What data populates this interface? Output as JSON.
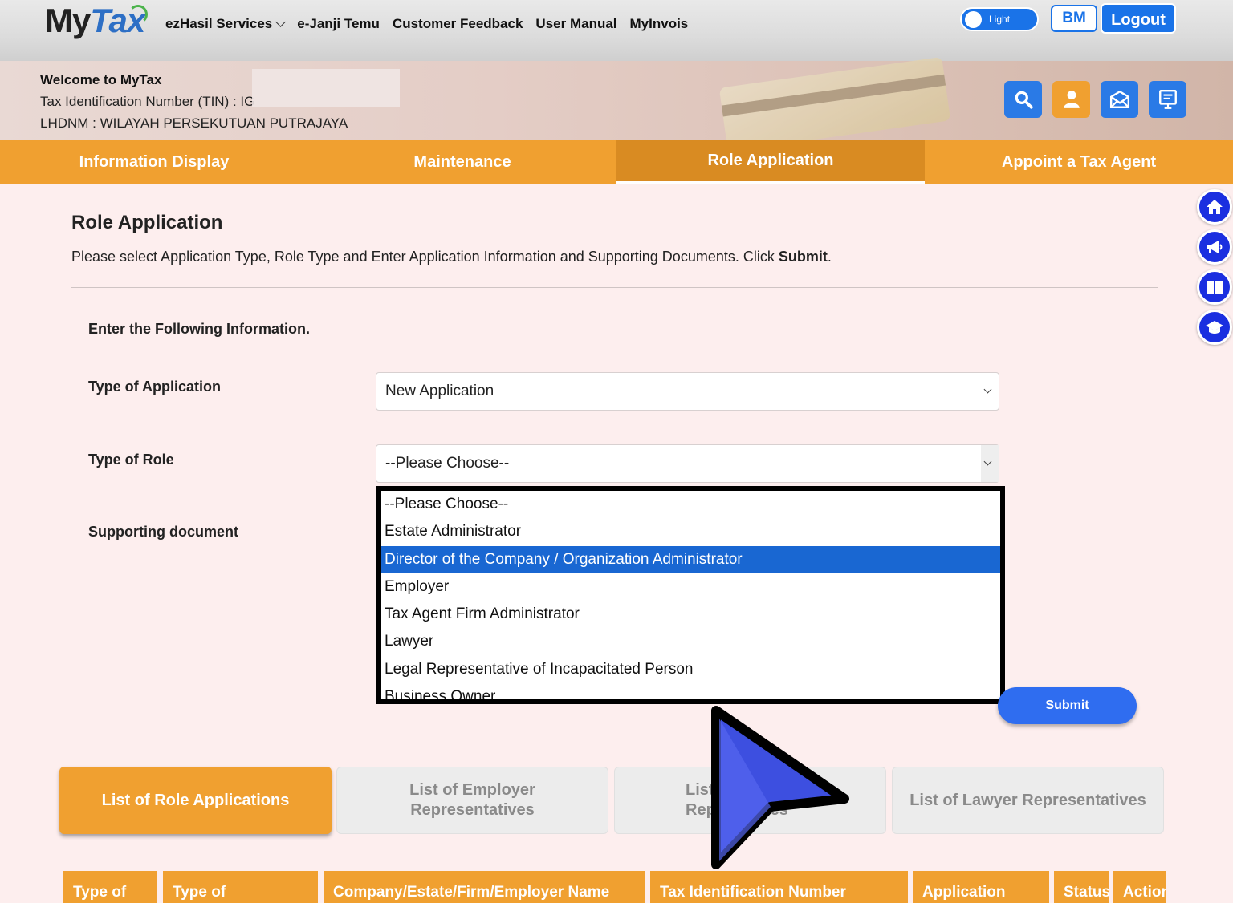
{
  "topnav": {
    "logo_my": "My",
    "logo_tax": "Tax",
    "items": [
      {
        "label": "ezHasil Services",
        "has_dropdown": true
      },
      {
        "label": "e-Janji Temu"
      },
      {
        "label": "Customer Feedback"
      },
      {
        "label": "User Manual"
      },
      {
        "label": "MyInvois"
      }
    ],
    "theme_toggle_label": "Light",
    "bm_label": "BM",
    "logout_label": "Logout"
  },
  "banner": {
    "welcome": "Welcome to MyTax",
    "tin": "Tax Identification Number (TIN) : IG",
    "lhdnm": "LHDNM : WILAYAH PERSEKUTUAN PUTRAJAYA",
    "icons": [
      "search-icon",
      "user-icon",
      "mail-icon",
      "presentation-icon"
    ]
  },
  "tabs": [
    {
      "label": "Information Display",
      "active": false
    },
    {
      "label": "Maintenance",
      "active": false
    },
    {
      "label": "Role Application",
      "active": true
    },
    {
      "label": "Appoint a Tax Agent",
      "active": false
    }
  ],
  "float_icons": [
    "home-icon",
    "megaphone-icon",
    "book-icon",
    "graduation-cap-icon"
  ],
  "main": {
    "title": "Role Application",
    "desc_prefix": "Please select Application Type, Role Type and Enter Application Information and Supporting Documents. Click ",
    "desc_bold": "Submit",
    "desc_suffix": ".",
    "section_label": "Enter the Following Information.",
    "type_of_application_label": "Type of Application",
    "type_of_application_value": "New Application",
    "type_of_role_label": "Type of Role",
    "type_of_role_value": "--Please Choose--",
    "supporting_doc_label": "Supporting document",
    "submit_label": "Submit"
  },
  "role_options": [
    {
      "label": "--Please Choose--",
      "selected": false
    },
    {
      "label": "Estate Administrator",
      "selected": false
    },
    {
      "label": "Director of the Company / Organization Administrator",
      "selected": true
    },
    {
      "label": "Employer",
      "selected": false
    },
    {
      "label": "Tax Agent Firm Administrator",
      "selected": false
    },
    {
      "label": "Lawyer",
      "selected": false
    },
    {
      "label": "Legal Representative of Incapacitated Person",
      "selected": false
    },
    {
      "label": "Business Owner",
      "selected": false
    }
  ],
  "list_tabs": [
    {
      "line1": "List of Role Applications",
      "line2": "",
      "active": true
    },
    {
      "line1": "List of Employer",
      "line2": "Representatives",
      "active": false
    },
    {
      "line1": "List",
      "line2": "Rep      atives",
      "active": false
    },
    {
      "line1": "List of Lawyer Representatives",
      "line2": "",
      "active": false
    }
  ],
  "table_headers": [
    "Type of",
    "Type of",
    "Company/Estate/Firm/Employer Name",
    "Tax Identification Number",
    "Application",
    "Status",
    "Action"
  ],
  "colors": {
    "orange": "#f0a030",
    "orange_active": "#d98b22",
    "blue": "#1a73e8",
    "select_highlight": "#1967d2",
    "page_bg": "#fdeeee"
  }
}
